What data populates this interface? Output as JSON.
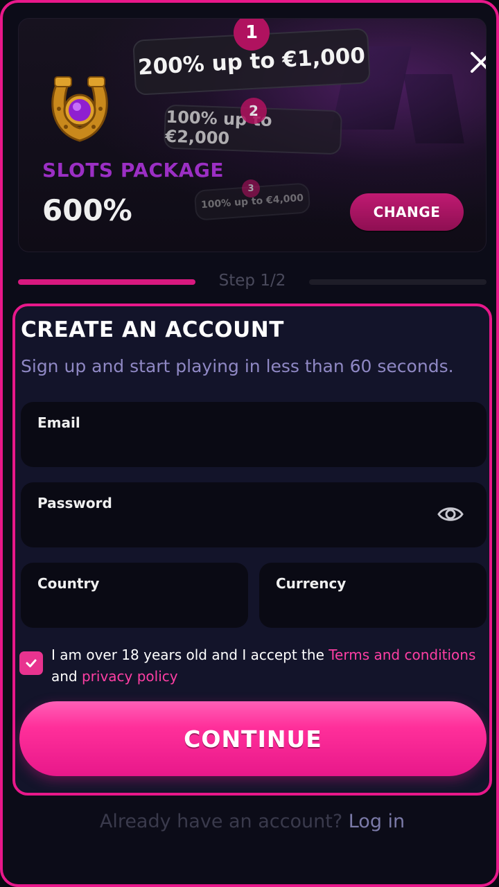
{
  "promo": {
    "tiers": [
      {
        "number": "1",
        "text": "200% up to €1,000"
      },
      {
        "number": "2",
        "text": "100% up to €2,000"
      },
      {
        "number": "3",
        "text": "100% up to €4,000"
      }
    ],
    "package_name": "SLOTS PACKAGE",
    "package_percent": "600%",
    "change_label": "CHANGE",
    "close_icon": "close-icon",
    "package_icon": "horseshoe-gem-icon"
  },
  "steps": {
    "label": "Step 1/2",
    "current": 1,
    "total": 2
  },
  "form": {
    "title": "CREATE AN ACCOUNT",
    "subtitle": "Sign up and start playing in less than 60 seconds.",
    "email_label": "Email",
    "email_value": "",
    "password_label": "Password",
    "password_value": "",
    "password_toggle_icon": "eye-icon",
    "country_label": "Country",
    "currency_label": "Currency",
    "terms_checked": true,
    "terms_prefix": "I am over 18 years old and I accept the ",
    "terms_link": "Terms and conditions",
    "terms_mid": "and ",
    "privacy_link": "privacy policy",
    "continue_label": "CONTINUE"
  },
  "footer": {
    "prompt": "Already have an account? ",
    "login_link": "Log in"
  },
  "colors": {
    "accent": "#e8188a",
    "link": "#ff3fa4",
    "background": "#0c0c18",
    "card": "#13142a"
  }
}
